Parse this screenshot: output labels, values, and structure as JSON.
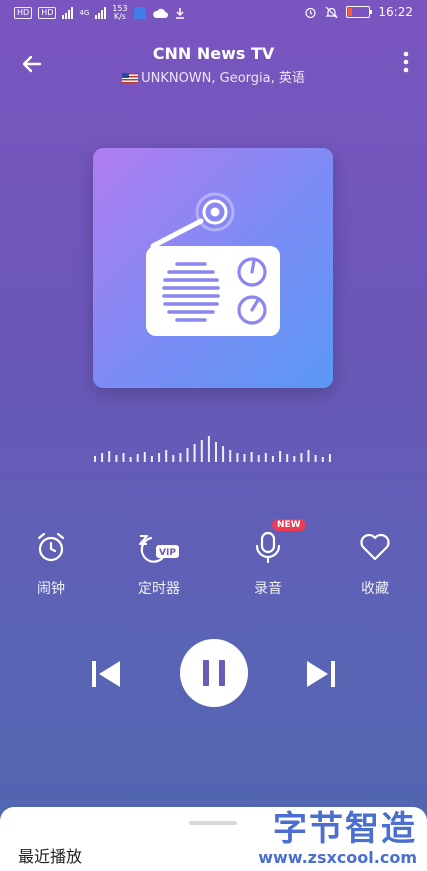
{
  "status_bar": {
    "left_chip1": "HD",
    "left_chip2": "HD",
    "network1": "4G",
    "network2": "4G",
    "speed_value": "153",
    "speed_unit": "K/s",
    "time": "16:22"
  },
  "header": {
    "title": "CNN News TV",
    "subtitle": "UNKNOWN, Georgia, 英语"
  },
  "actions": [
    {
      "label": "闹钟"
    },
    {
      "label": "定时器",
      "badge_text": "VIP"
    },
    {
      "label": "录音",
      "badge": "NEW"
    },
    {
      "label": "收藏"
    }
  ],
  "playback": {
    "state": "playing"
  },
  "bottom_sheet": {
    "title": "最近播放"
  },
  "watermark": {
    "line1": "字节智造",
    "line2": "www.zsxcool.com"
  },
  "colors": {
    "accent": "#6a5bb5",
    "new_badge": "#ea3b57",
    "battery_low": "#ff5a3c"
  }
}
